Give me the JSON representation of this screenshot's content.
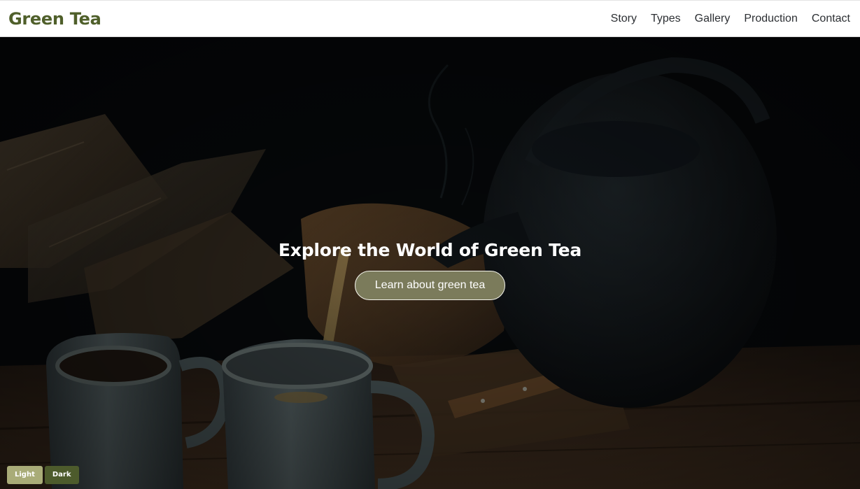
{
  "brand": {
    "title": "Green Tea"
  },
  "nav": {
    "items": [
      {
        "label": "Story"
      },
      {
        "label": "Types"
      },
      {
        "label": "Gallery"
      },
      {
        "label": "Production"
      },
      {
        "label": "Contact"
      }
    ]
  },
  "hero": {
    "title": "Explore the World of Green Tea",
    "cta_label": "Learn about green tea"
  },
  "theme": {
    "light_label": "Light",
    "dark_label": "Dark"
  },
  "colors": {
    "brand": "#4f5f2a",
    "cta_background": "#7b7b5b",
    "light_button": "#a9ac78",
    "dark_button": "#4d5b2c"
  }
}
